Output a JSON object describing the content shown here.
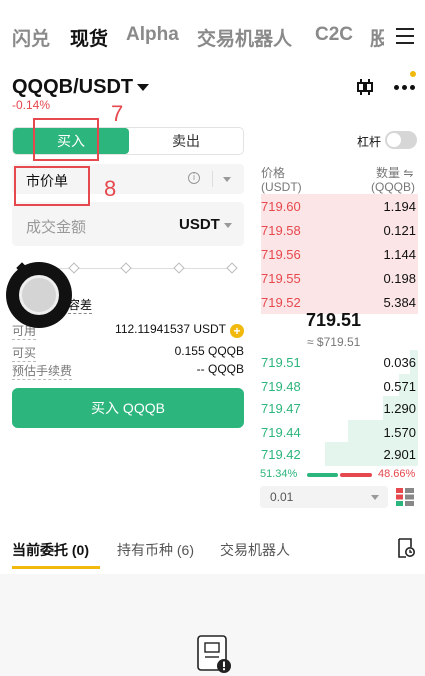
{
  "nav": {
    "tabs": [
      "闪兑",
      "现货",
      "Alpha",
      "交易机器人",
      "C2C",
      "股"
    ],
    "active_index": 1,
    "menu_icon": "hamburger-menu-icon"
  },
  "pair": {
    "symbol": "QQQB/USDT",
    "change": "-0.14%",
    "chart_icon": "candlestick-icon",
    "more_icon": "more-dots-icon"
  },
  "order_form": {
    "buy_label": "买入",
    "sell_label": "卖出",
    "leverage_label": "杠杆",
    "leverage_on": false,
    "order_type": "市价单",
    "amount_placeholder": "成交金额",
    "amount_unit": "USDT",
    "slider_percent": 0,
    "tolerance_label": "容差",
    "available_label": "可用",
    "available_value": "112.11941537 USDT",
    "can_buy_label": "可买",
    "can_buy_value": "0.155 QQQB",
    "fee_label": "预估手续费",
    "fee_value": "-- QQQB",
    "submit_label": "买入 QQQB"
  },
  "order_book": {
    "price_header": "价格",
    "price_unit": "(USDT)",
    "qty_header": "数量 ⇋",
    "qty_unit": "(QQQB)",
    "asks": [
      {
        "price": "719.60",
        "qty": "1.194",
        "depth": 0.98
      },
      {
        "price": "719.58",
        "qty": "0.121",
        "depth": 0.98
      },
      {
        "price": "719.56",
        "qty": "1.144",
        "depth": 0.98
      },
      {
        "price": "719.55",
        "qty": "0.198",
        "depth": 0.98
      },
      {
        "price": "719.52",
        "qty": "5.384",
        "depth": 0.98
      }
    ],
    "mid_price": "719.51",
    "mid_usd": "≈ $719.51",
    "bids": [
      {
        "price": "719.51",
        "qty": "0.036",
        "depth": 0.05
      },
      {
        "price": "719.48",
        "qty": "0.571",
        "depth": 0.12
      },
      {
        "price": "719.47",
        "qty": "1.290",
        "depth": 0.22
      },
      {
        "price": "719.44",
        "qty": "1.570",
        "depth": 0.44
      },
      {
        "price": "719.42",
        "qty": "2.901",
        "depth": 0.58
      }
    ],
    "buy_ratio": "51.34%",
    "sell_ratio": "48.66%",
    "precision": "0.01"
  },
  "bottom_tabs": {
    "tabs": [
      "当前委托 (0)",
      "持有币种 (6)",
      "交易机器人"
    ],
    "active_index": 0
  },
  "annotations": {
    "label_7": "7",
    "label_8": "8"
  },
  "colors": {
    "green": "#2cb57c",
    "red": "#e5484d",
    "yellow": "#f0b90b"
  }
}
